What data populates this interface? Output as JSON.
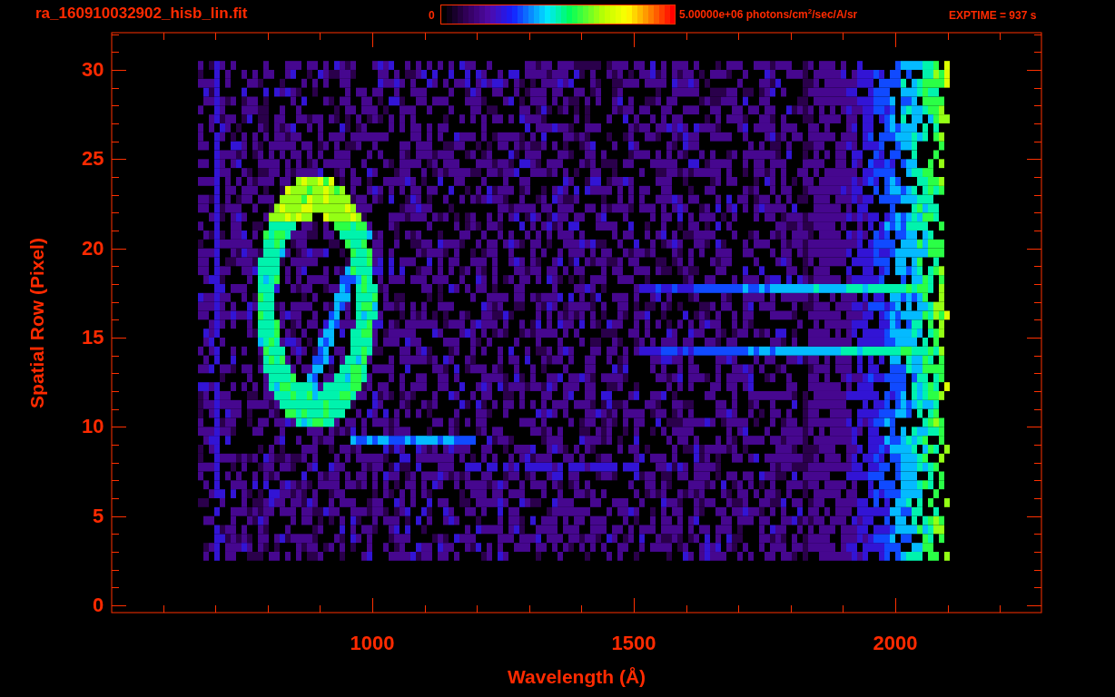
{
  "title": "ra_160910032902_hisb_lin.fit",
  "colorbar": {
    "min_label": "0",
    "max_label": "5.00000e+06 photons/cm$^{2}$/sec/A/sr"
  },
  "exposure": "EXPTIME = 937 s",
  "y_axis": {
    "label": "Spatial Row (Pixel)",
    "ticks": [
      "30",
      "25",
      "20",
      "15",
      "10",
      "5",
      "0"
    ]
  },
  "x_axis": {
    "label": "Wavelength (Å)",
    "ticks": [
      "1000",
      "1500",
      "2000"
    ]
  }
}
